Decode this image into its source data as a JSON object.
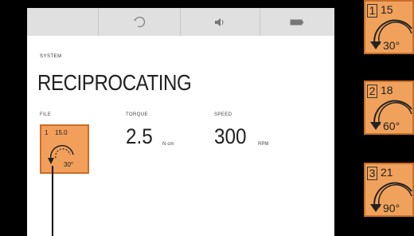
{
  "status_bar": {
    "icons": [
      "rotation-icon",
      "speaker-icon",
      "battery-icon"
    ]
  },
  "main": {
    "system_label": "SYSTEM",
    "mode": "RECIPROCATING",
    "file": {
      "label": "FILE",
      "number": "1",
      "code": "15.0",
      "angle": "30°"
    },
    "torque": {
      "label": "TORQUE",
      "value": "2.5",
      "unit": "N·cm"
    },
    "speed": {
      "label": "SPEED",
      "value": "300",
      "unit": "RPM"
    }
  },
  "tiles": [
    {
      "number": "1",
      "code": "15",
      "angle": "30°"
    },
    {
      "number": "2",
      "code": "18",
      "angle": "60°"
    },
    {
      "number": "3",
      "code": "21",
      "angle": "90°"
    }
  ],
  "colors": {
    "accent": "#f0a25d",
    "accent_border": "#c86e28",
    "screen_bg": "#ffffff",
    "status_bg": "#e0e0e0"
  }
}
